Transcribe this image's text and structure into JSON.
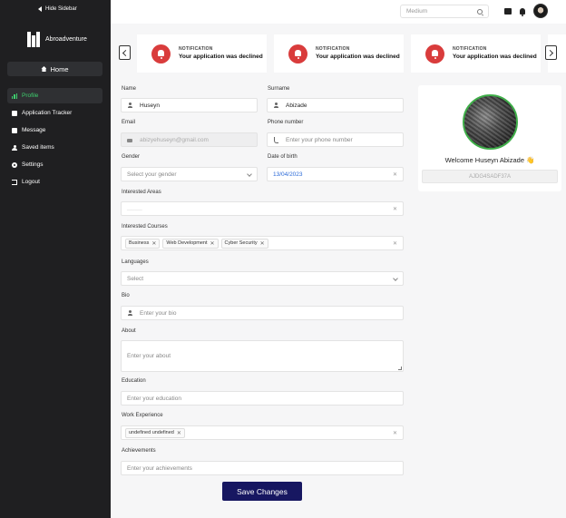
{
  "sidebar": {
    "hide_label": "Hide Sidebar",
    "logo_text": "Abroadventure",
    "home_label": "Home",
    "items": [
      {
        "label": "Profile",
        "icon": "chart-bars-icon",
        "active": true
      },
      {
        "label": "Application Tracker",
        "icon": "tracker-icon",
        "active": false
      },
      {
        "label": "Message",
        "icon": "message-icon",
        "active": false
      },
      {
        "label": "Saved items",
        "icon": "user-icon",
        "active": false
      },
      {
        "label": "Settings",
        "icon": "gear-icon",
        "active": false
      },
      {
        "label": "Logout",
        "icon": "logout-icon",
        "active": false
      }
    ]
  },
  "topbar": {
    "search_placeholder": "Medium"
  },
  "notifications": [
    {
      "title": "NOTIFICATION",
      "message": "Your application was declined"
    },
    {
      "title": "NOTIFICATION",
      "message": "Your application was declined"
    },
    {
      "title": "NOTIFICATION",
      "message": "Your application was declined"
    }
  ],
  "form": {
    "name": {
      "label": "Name",
      "value": "Huseyn"
    },
    "surname": {
      "label": "Surname",
      "value": "Abizade"
    },
    "email": {
      "label": "Email",
      "value": "abizyehuseyn@gmail.com"
    },
    "phone": {
      "label": "Phone number",
      "placeholder": "Enter your phone number"
    },
    "gender": {
      "label": "Gender",
      "placeholder": "Select your gender"
    },
    "dob": {
      "label": "Date of birth",
      "value": "13/04/2023"
    },
    "interested_areas": {
      "label": "Interested Areas",
      "value": "______"
    },
    "interested_courses": {
      "label": "Interested Courses",
      "tags": [
        "Business",
        "Web Development",
        "Cyber Security"
      ]
    },
    "languages": {
      "label": "Languages",
      "placeholder": "Select"
    },
    "bio": {
      "label": "Bio",
      "placeholder": "Enter your bio"
    },
    "about": {
      "label": "About",
      "placeholder": "Enter your about"
    },
    "education": {
      "label": "Education",
      "placeholder": "Enter your education"
    },
    "work_experience": {
      "label": "Work Experience",
      "tags": [
        "undefined undefined"
      ]
    },
    "achievements": {
      "label": "Achievements",
      "placeholder": "Enter your achievements"
    },
    "save_label": "Save Changes"
  },
  "profile": {
    "welcome": "Welcome Huseyn Abizade 👋",
    "user_id": "AJDG4SADF37A"
  },
  "colors": {
    "sidebar_bg": "#1f1f21",
    "active_green": "#3ecf6e",
    "notification_red": "#d93c3c",
    "save_button": "#171761",
    "date_blue": "#2c6bd8"
  }
}
